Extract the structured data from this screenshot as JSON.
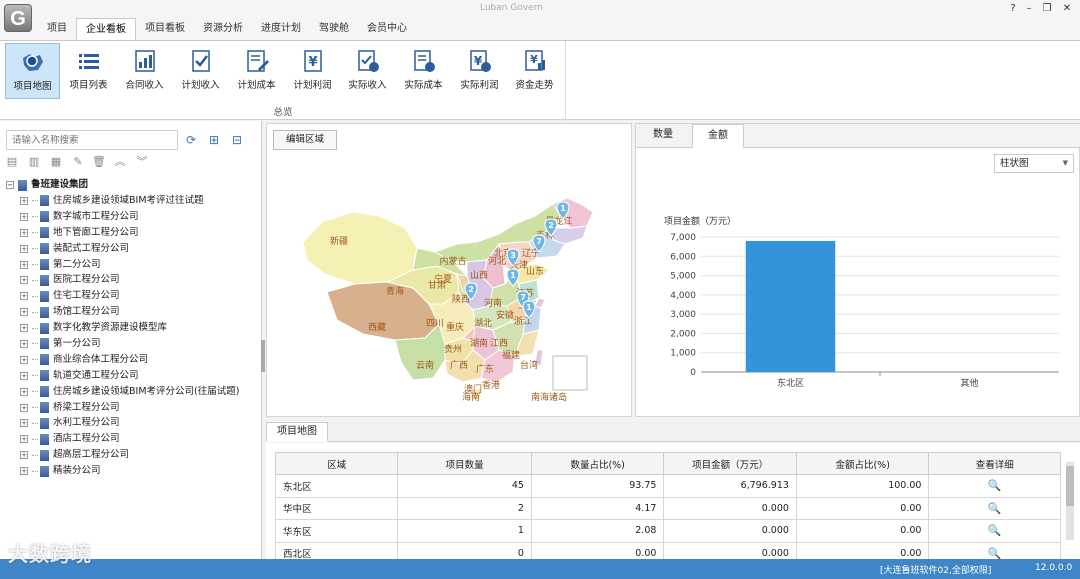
{
  "window": {
    "title": "Luban Govern"
  },
  "menu": {
    "tabs": [
      "项目",
      "企业看板",
      "项目看板",
      "资源分析",
      "进度计划",
      "驾驶舱",
      "会员中心"
    ],
    "active": "企业看板"
  },
  "ribbon": {
    "buttons": [
      {
        "label": "项目地图",
        "icon": "map-icon"
      },
      {
        "label": "项目列表",
        "icon": "list-icon"
      },
      {
        "label": "合同收入",
        "icon": "chart-icon"
      },
      {
        "label": "计划收入",
        "icon": "check-doc-icon"
      },
      {
        "label": "计划成本",
        "icon": "edit-doc-icon"
      },
      {
        "label": "计划利润",
        "icon": "yen-doc-icon"
      },
      {
        "label": "实际收入",
        "icon": "check-coin-icon"
      },
      {
        "label": "实际成本",
        "icon": "doc-coin-icon"
      },
      {
        "label": "实际利润",
        "icon": "yen-coin-icon"
      },
      {
        "label": "资金走势",
        "icon": "yen-chart-icon"
      }
    ],
    "group_label": "总览"
  },
  "left": {
    "search_placeholder": "请输入名称搜索",
    "root": "鲁班建设集团",
    "items": [
      "住房城乡建设领域BIM考评过往试题",
      "数字城市工程分公司",
      "地下管廊工程分公司",
      "装配式工程分公司",
      "第二分公司",
      "医院工程分公司",
      "住宅工程分公司",
      "场馆工程分公司",
      "数字化教学资源建设模型库",
      "第一分公司",
      "商业综合体工程分公司",
      "轨道交通工程分公司",
      "住房城乡建设领域BIM考评分公司(往届试题)",
      "桥梁工程分公司",
      "水利工程分公司",
      "酒店工程分公司",
      "超高层工程分公司",
      "精装分公司"
    ]
  },
  "map": {
    "edit_button": "编辑区域",
    "labels": [
      "新疆",
      "西藏",
      "青海",
      "甘肃",
      "内蒙古",
      "宁夏",
      "陕西",
      "山西",
      "河北",
      "北京",
      "天津",
      "辽宁",
      "吉林",
      "黑龙江",
      "山东",
      "河南",
      "湖北",
      "四川",
      "重庆",
      "贵州",
      "云南",
      "广西",
      "广东",
      "湖南",
      "江西",
      "安徽",
      "江苏",
      "上海",
      "浙江",
      "福建",
      "台湾",
      "海南",
      "香港",
      "澳门",
      "南海诸岛"
    ],
    "markers": [
      "1",
      "2",
      "7",
      "3",
      "1",
      "2",
      "7",
      "1"
    ]
  },
  "chart_tabs": [
    "数量",
    "金额"
  ],
  "chart_tab_active": "金额",
  "chart_type": "柱状图",
  "chart_data": {
    "type": "bar",
    "categories": [
      "东北区",
      "其他"
    ],
    "values": [
      6796.913,
      0
    ],
    "ylabel": "项目金额（万元）",
    "ylim": [
      0,
      7000
    ],
    "yticks": [
      "0",
      "1,000",
      "2,000",
      "3,000",
      "4,000",
      "5,000",
      "6,000",
      "7,000"
    ],
    "color": "#3394dc"
  },
  "bottom_tab": "项目地图",
  "table": {
    "columns": [
      "区域",
      "项目数量",
      "数量占比(%)",
      "项目金额（万元）",
      "金额占比(%)",
      "查看详细"
    ],
    "rows": [
      [
        "东北区",
        "45",
        "93.75",
        "6,796.913",
        "100.00"
      ],
      [
        "华中区",
        "2",
        "4.17",
        "0.000",
        "0.00"
      ],
      [
        "华东区",
        "1",
        "2.08",
        "0.000",
        "0.00"
      ],
      [
        "西北区",
        "0",
        "0.00",
        "0.000",
        "0.00"
      ]
    ]
  },
  "status": {
    "user": "[大连鲁班软件02,全部权限]",
    "version": "12.0.0.0"
  },
  "watermark": "大数跨境"
}
